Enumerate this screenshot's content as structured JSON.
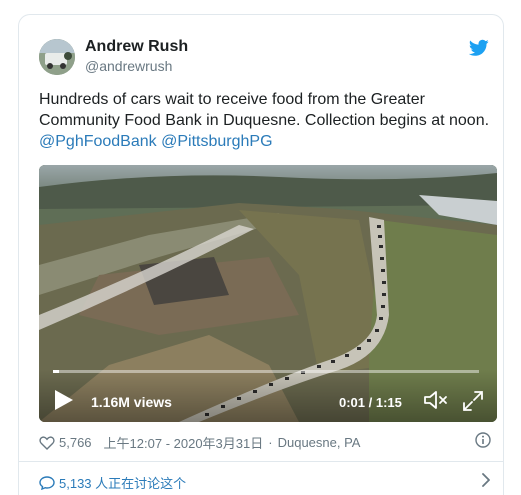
{
  "author": {
    "name": "Andrew Rush",
    "handle": "@andrewrush"
  },
  "tweet": {
    "text": "Hundreds of cars wait to receive food from the Greater Community Food Bank in Duquesne. Collection begins at noon.",
    "mentions": [
      "@PghFoodBank",
      "@PittsburghPG"
    ]
  },
  "video": {
    "views": "1.16M views",
    "time": "0:01 / 1:15",
    "progress": 0.013
  },
  "meta": {
    "likes": "5,766",
    "timestamp": "上午12:07 - 2020年3月31日",
    "separator": "·",
    "location": "Duquesne, PA"
  },
  "discussion": {
    "label": "5,133 人正在讨论这个"
  },
  "icons": {
    "brand": "twitter-bird-icon",
    "like": "heart-icon",
    "info": "info-icon",
    "comment": "comment-icon",
    "chevron": "chevron-right-icon",
    "play": "play-icon",
    "volume": "volume-icon",
    "fullscreen": "fullscreen-icon"
  },
  "colors": {
    "link": "#2b7bb9",
    "twitter_blue": "#1da1f2",
    "muted": "#697882",
    "text": "#1c2022"
  }
}
